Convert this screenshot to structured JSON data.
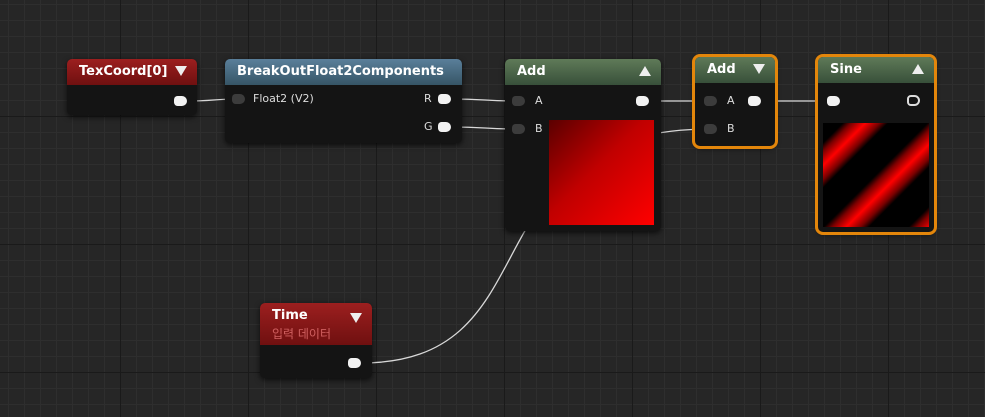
{
  "nodes": {
    "texcoord": {
      "title": "TexCoord[0]"
    },
    "breakout": {
      "title": "BreakOutFloat2Components",
      "input_label": "Float2 (V2)",
      "out_r": "R",
      "out_g": "G"
    },
    "add1": {
      "title": "Add",
      "in_a": "A",
      "in_b": "B"
    },
    "add2": {
      "title": "Add",
      "in_a": "A",
      "in_b": "B"
    },
    "sine": {
      "title": "Sine"
    },
    "time": {
      "title": "Time",
      "subtitle": "입력 데이터"
    }
  },
  "colors": {
    "selected_outline": "#e3860b",
    "red_header": "#9c1f1f",
    "blue_header": "#5a7f9a",
    "green_header": "#5f7a58",
    "preview_red": "#ff0000"
  },
  "icons": [
    "collapse-arrow-down-icon",
    "collapse-arrow-up-icon",
    "pin-icon"
  ]
}
